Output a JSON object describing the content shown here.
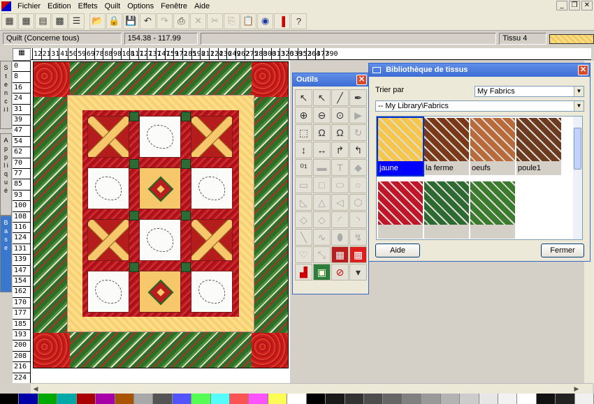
{
  "menu": {
    "items": [
      "Fichier",
      "Edition",
      "Effets",
      "Quilt",
      "Options",
      "Fenêtre",
      "Aide"
    ]
  },
  "toolbar": {
    "icons": [
      "new-grid-icon",
      "grid-icon",
      "layout-icon",
      "pieced-grid-icon",
      "border-icon",
      "open-folder-icon",
      "save-all-icon",
      "save-icon",
      "undo-icon",
      "redo-icon",
      "print-icon",
      "delete-icon",
      "cut-icon",
      "copy-icon",
      "paste-icon",
      "globe-icon",
      "color-pencil-icon",
      "help-icon"
    ]
  },
  "status": {
    "quilt_label": "Quilt (Concerne tous)",
    "coordinates": "154.38 - 117.99",
    "fabric_label": "Tissu 4"
  },
  "ruler": {
    "h_ticks": [
      "12",
      "21",
      "31",
      "41",
      "50",
      "59",
      "69",
      "78",
      "88",
      "98",
      "108",
      "117",
      "127",
      "137",
      "147",
      "159",
      "172",
      "185",
      "198",
      "211",
      "224",
      "236",
      "249",
      "262",
      "275",
      "288",
      "300",
      "313",
      "326",
      "339",
      "352",
      "364",
      "377",
      "390"
    ],
    "v_ticks": [
      "0",
      "8",
      "16",
      "24",
      "31",
      "39",
      "47",
      "54",
      "62",
      "70",
      "77",
      "85",
      "93",
      "100",
      "108",
      "116",
      "124",
      "131",
      "139",
      "147",
      "154",
      "162",
      "170",
      "177",
      "185",
      "193",
      "200",
      "208",
      "216",
      "224"
    ]
  },
  "side_tabs": {
    "stencil": "S t e n c i l",
    "applique": "A p p l i q u é",
    "base": "B a s e"
  },
  "outils": {
    "title": "Outils",
    "tools": [
      "select-arrow-icon",
      "node-arrow-icon",
      "brush-icon",
      "eyedropper-icon",
      "zoom-in-icon",
      "zoom-out-icon",
      "zoom-fit-icon",
      "pointer-icon",
      "select-box-icon",
      "magnet-icon",
      "magnet-alt-icon",
      "rotate-icon",
      "vertical-resize-icon",
      "horizontal-resize-icon",
      "corner-right-icon",
      "corner-left-icon",
      "measure-icon",
      "ruler-icon",
      "text-icon",
      "diamond-icon",
      "rectangle-icon",
      "square-icon",
      "ellipse-icon",
      "circle-icon",
      "triangle-right-icon",
      "triangle-icon",
      "pentagon-left-icon",
      "hexagon-icon",
      "lens-icon",
      "leaf-icon",
      "quarter-circle-icon",
      "arc-icon",
      "line-icon",
      "curve-icon",
      "vase-icon",
      "bent-arrow-icon",
      "heart-icon",
      "expand-icon",
      "block-pattern-icon",
      "fabric-dots-icon",
      "stack-icon",
      "picture-icon",
      "no-fabric-icon",
      "color-menu-icon"
    ],
    "tool_glyphs": [
      "↖",
      "↖",
      "╱",
      "✒",
      "⊕",
      "⊖",
      "⊙",
      "▶",
      "⬚",
      "Ω",
      "Ω",
      "↻",
      "↕",
      "↔",
      "↱",
      "↰",
      "⁰¹",
      "▬",
      "T",
      "◆",
      "▭",
      "□",
      "⬭",
      "○",
      "◺",
      "△",
      "◁",
      "⬡",
      "◇",
      "◇",
      "◜",
      "◝",
      "╲",
      "∿",
      "⬮",
      "↯",
      "♡",
      "⤡",
      "▦",
      "▩",
      "▟",
      "▣",
      "⊘",
      "▾"
    ]
  },
  "biblio": {
    "title": "Bibliothèque de tissus",
    "sort_label": "Trier par",
    "sort_value": "My Fabrics",
    "path_value": "-- My Library\\Fabrics",
    "fabrics": [
      {
        "name": "jaune",
        "selected": true,
        "color": "#f5c64a"
      },
      {
        "name": "la ferme",
        "selected": false,
        "color": "#7a3a1a"
      },
      {
        "name": "oeufs",
        "selected": false,
        "color": "#b96a3a"
      },
      {
        "name": "poule1",
        "selected": false,
        "color": "#6b3a1f"
      },
      {
        "name": "",
        "selected": false,
        "color": "#c1162a"
      },
      {
        "name": "",
        "selected": false,
        "color": "#2c6a32"
      },
      {
        "name": "",
        "selected": false,
        "color": "#3a7b2e"
      }
    ],
    "help_button": "Aide",
    "close_button": "Fermer"
  },
  "palette": {
    "colors": [
      "#000000",
      "#0000a8",
      "#00a800",
      "#00a8a8",
      "#a80000",
      "#a800a8",
      "#a85400",
      "#a8a8a8",
      "#545454",
      "#5454fc",
      "#54fc54",
      "#54fcfc",
      "#fc5454",
      "#fc54fc",
      "#fcfc54",
      "#ffffff",
      "#000000",
      "#1a1a1a",
      "#333333",
      "#4d4d4d",
      "#666666",
      "#808080",
      "#999999",
      "#b3b3b3",
      "#cccccc",
      "#e6e6e6",
      "#f2f2f2",
      "#ffffff",
      "#111111",
      "#222222",
      "#f0f0f0"
    ]
  }
}
